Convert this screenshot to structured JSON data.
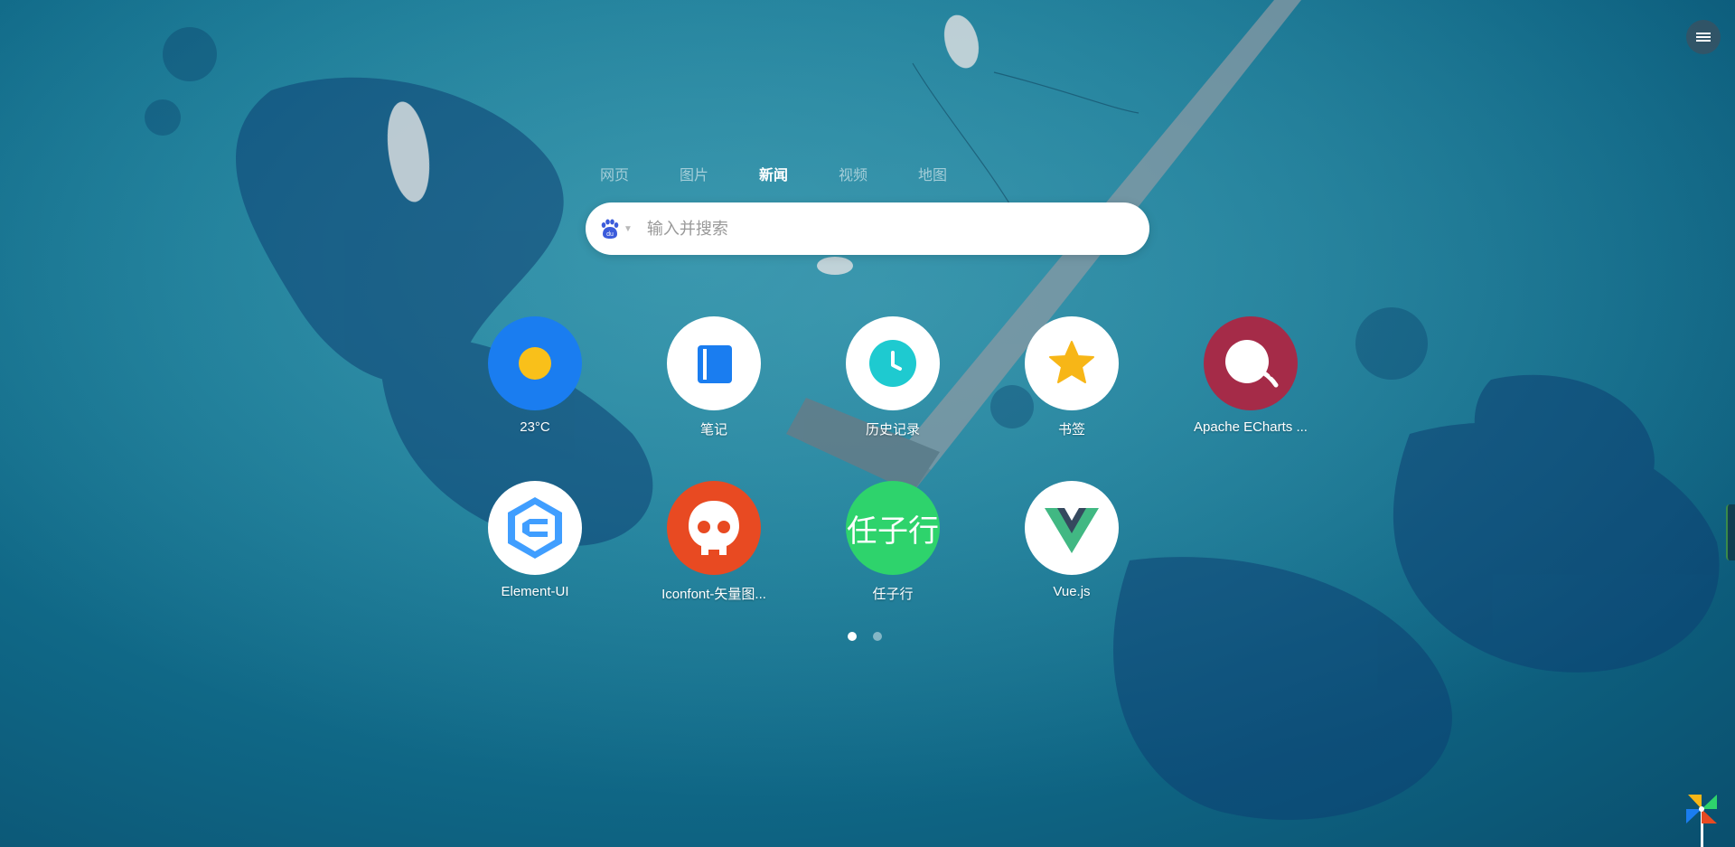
{
  "header": {
    "menu_icon": "hamburger-menu-icon"
  },
  "search": {
    "tabs": [
      {
        "label": "网页",
        "active": false
      },
      {
        "label": "图片",
        "active": false
      },
      {
        "label": "新闻",
        "active": true
      },
      {
        "label": "视频",
        "active": false
      },
      {
        "label": "地图",
        "active": false
      }
    ],
    "engine_icon": "baidu-paw-icon",
    "placeholder": "输入并搜索"
  },
  "apps": [
    {
      "label": "23°C",
      "icon": "weather-sun-icon",
      "bg": "#1a7df0"
    },
    {
      "label": "笔记",
      "icon": "notebook-icon",
      "bg": "#ffffff"
    },
    {
      "label": "历史记录",
      "icon": "clock-icon",
      "bg": "#ffffff"
    },
    {
      "label": "书签",
      "icon": "star-icon",
      "bg": "#ffffff"
    },
    {
      "label": "Apache ECharts ...",
      "icon": "echarts-logo-icon",
      "bg": "#a52b48"
    },
    {
      "label": "Element-UI",
      "icon": "element-ui-logo-icon",
      "bg": "#ffffff"
    },
    {
      "label": "Iconfont-矢量图...",
      "icon": "iconfont-skull-icon",
      "bg": "#e84a22"
    },
    {
      "label": "任子行",
      "icon": "renzixing-text-icon",
      "icon_text": "任子行",
      "bg": "#2ed36c"
    },
    {
      "label": "Vue.js",
      "icon": "vue-logo-icon",
      "bg": "#ffffff"
    }
  ],
  "pager": {
    "pages": 2,
    "current": 1
  },
  "colors": {
    "accent_blue": "#1a7df0",
    "sun_yellow": "#f9c01a",
    "clock_teal": "#1ecad0",
    "star_gold": "#f7b617"
  }
}
